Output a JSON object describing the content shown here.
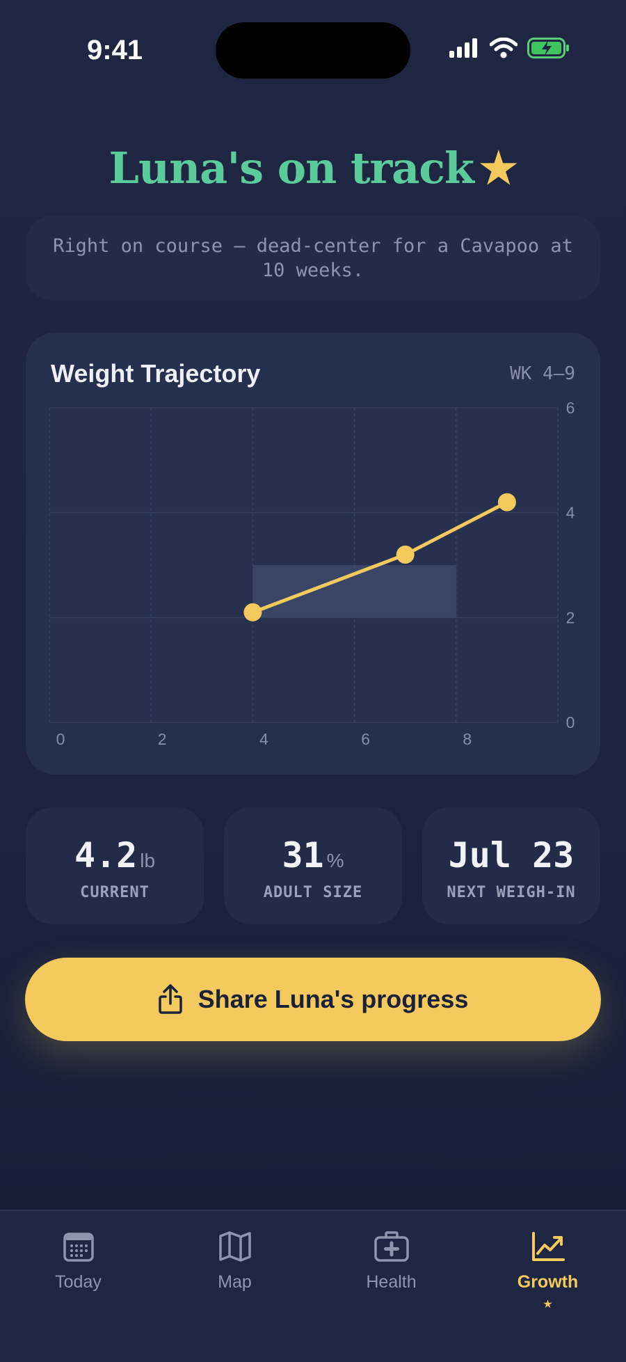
{
  "status_bar": {
    "time": "9:41"
  },
  "headline": {
    "text": "Luna's on track",
    "star": "★"
  },
  "message": "Right on course — dead-center for a Cavapoo at 10 weeks.",
  "chart": {
    "title": "Weight Trajectory",
    "range_label": "WK 4–9"
  },
  "chart_data": {
    "type": "line",
    "title": "Weight Trajectory",
    "x_ticks": [
      "0",
      "2",
      "4",
      "6",
      "8"
    ],
    "y_ticks": [
      "0",
      "2",
      "4",
      "6"
    ],
    "xlim": [
      0,
      10
    ],
    "ylim": [
      0,
      6
    ],
    "grid": true,
    "series": [
      {
        "x": [
          4,
          7,
          9
        ],
        "y": [
          2.1,
          3.2,
          4.2
        ],
        "color": "#f4c95d"
      }
    ],
    "band": {
      "x": [
        4,
        8
      ],
      "y": [
        2,
        3
      ],
      "color": "#3a4566"
    }
  },
  "stats": [
    {
      "value": "4.2",
      "unit": "lb",
      "label": "CURRENT"
    },
    {
      "value": "31",
      "unit": "%",
      "label": "ADULT SIZE"
    },
    {
      "value": "Jul 23",
      "unit": "",
      "label": "NEXT WEIGH-IN"
    }
  ],
  "cta": {
    "label": "Share Luna's progress",
    "icon": "share-icon"
  },
  "tabs": [
    {
      "label": "Today",
      "icon": "calendar-icon",
      "active": false
    },
    {
      "label": "Map",
      "icon": "map-icon",
      "active": false
    },
    {
      "label": "Health",
      "icon": "medical-kit-icon",
      "active": false
    },
    {
      "label": "Growth",
      "icon": "growth-chart-icon",
      "active": true,
      "marker": "★"
    }
  ],
  "colors": {
    "accent": "#f4c95d",
    "headline": "#5ccb9c",
    "background": "#1e2642"
  }
}
